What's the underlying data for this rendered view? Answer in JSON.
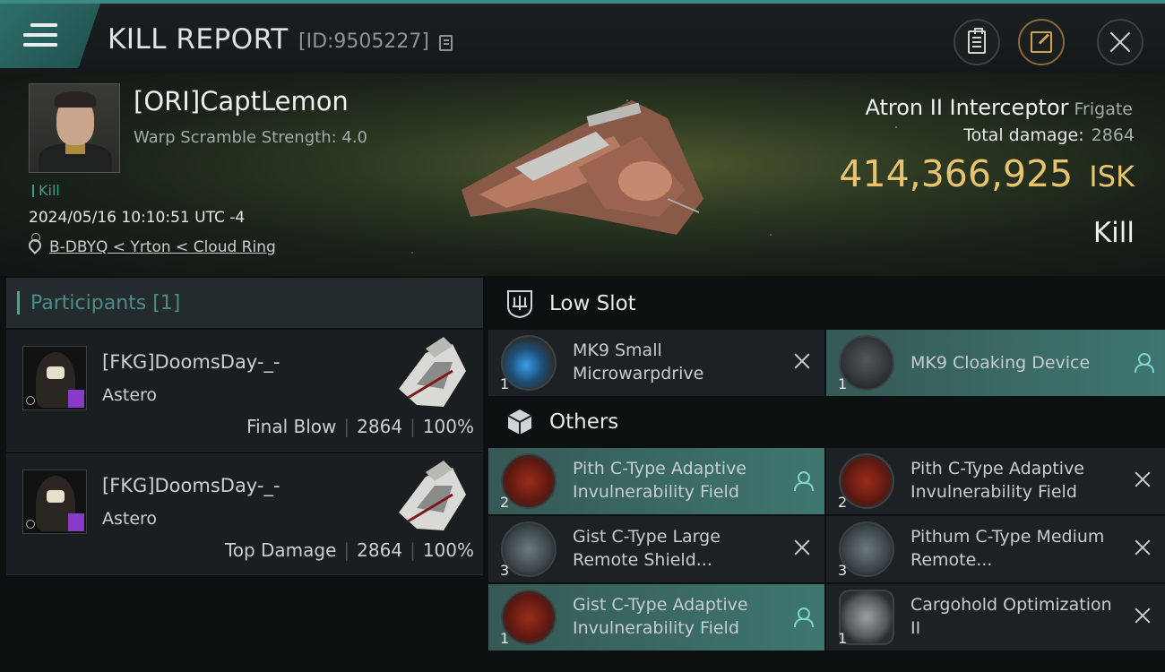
{
  "header": {
    "title": "KILL REPORT",
    "kill_id": "[ID:9505227]"
  },
  "victim": {
    "name": "[ORI]CaptLemon",
    "warp_scramble": "Warp Scramble Strength: 4.0",
    "kill_tag": "Kill",
    "datetime": "2024/05/16 10:10:51 UTC -4",
    "location": "B-DBYQ < Yrton < Cloud Ring",
    "ship": "Atron II Interceptor",
    "ship_class": "Frigate",
    "total_damage_label": "Total damage:",
    "total_damage": "2864",
    "isk_value": "414,366,925",
    "isk_unit": "ISK",
    "result": "Kill"
  },
  "participants": {
    "title": "Participants [1]",
    "rows": [
      {
        "name": "[FKG]DoomsDay-_-",
        "ship": "Astero",
        "role": "Final Blow",
        "damage": "2864",
        "percent": "100%"
      },
      {
        "name": "[FKG]DoomsDay-_-",
        "ship": "Astero",
        "role": "Top Damage",
        "damage": "2864",
        "percent": "100%"
      }
    ]
  },
  "low_slot": {
    "title": "Low Slot",
    "items": [
      {
        "name": "MK9 Small Microwarpdrive",
        "qty": "1",
        "state": "destroyed",
        "icon": "microwarpdrive-icon"
      },
      {
        "name": "MK9 Cloaking Device",
        "qty": "1",
        "state": "dropped",
        "icon": "cloaking-device-icon"
      }
    ]
  },
  "others": {
    "title": "Others",
    "items": [
      {
        "name": "Pith C-Type Adaptive Invulnerability Field",
        "qty": "2",
        "state": "dropped",
        "icon": "invulnerability-field-icon"
      },
      {
        "name": "Pith C-Type Adaptive Invulnerability Field",
        "qty": "2",
        "state": "destroyed",
        "icon": "invulnerability-field-icon"
      },
      {
        "name": "Gist C-Type Large Remote Shield...",
        "qty": "3",
        "state": "destroyed",
        "icon": "remote-shield-icon"
      },
      {
        "name": "Pithum C-Type Medium Remote...",
        "qty": "3",
        "state": "destroyed",
        "icon": "remote-shield-icon"
      },
      {
        "name": "Gist C-Type Adaptive Invulnerability Field",
        "qty": "1",
        "state": "dropped",
        "icon": "invulnerability-field-icon"
      },
      {
        "name": "Cargohold Optimization II",
        "qty": "1",
        "state": "destroyed",
        "icon": "cargohold-icon"
      }
    ]
  },
  "colors": {
    "accent": "#3f9a92",
    "isk_gold": "#e8c470",
    "dropped_highlight": "#3f7670"
  }
}
